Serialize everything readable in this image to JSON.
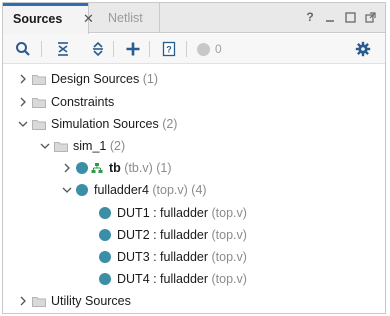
{
  "tabs": [
    {
      "label": "Sources",
      "active": true
    },
    {
      "label": "Netlist",
      "active": false
    }
  ],
  "toolbar": {
    "count": "0"
  },
  "tree": {
    "design_sources": {
      "label": "Design Sources",
      "meta": "(1)"
    },
    "constraints": {
      "label": "Constraints"
    },
    "simulation_sources": {
      "label": "Simulation Sources",
      "meta": "(2)"
    },
    "sim_1": {
      "label": "sim_1",
      "meta": "(2)"
    },
    "tb": {
      "label": "tb",
      "meta": "(tb.v) (1)"
    },
    "fulladder4": {
      "label": "fulladder4",
      "meta": "(top.v) (4)"
    },
    "duts": [
      {
        "label": "DUT1 : fulladder",
        "meta": "(top.v)"
      },
      {
        "label": "DUT2 : fulladder",
        "meta": "(top.v)"
      },
      {
        "label": "DUT3 : fulladder",
        "meta": "(top.v)"
      },
      {
        "label": "DUT4 : fulladder",
        "meta": "(top.v)"
      }
    ],
    "utility_sources": {
      "label": "Utility Sources"
    }
  },
  "colors": {
    "accent": "#2f6db5",
    "module_dot": "#3a8ea6",
    "toolbar_icon": "#2a5b8f",
    "tb_icon": "#2f9a46"
  }
}
